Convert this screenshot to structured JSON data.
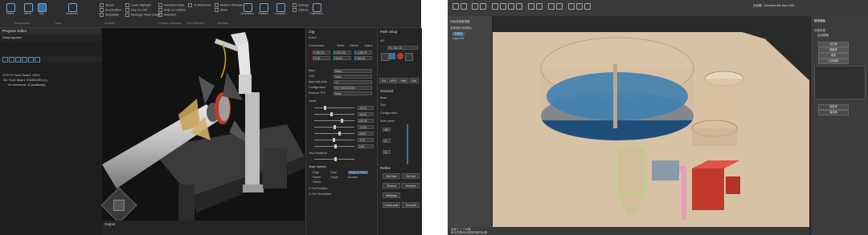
{
  "left_app": {
    "ribbon": {
      "buttons": [
        {
          "label": "Select",
          "icon": "cursor-icon"
        },
        {
          "label": "Move",
          "icon": "move-icon"
        },
        {
          "label": "Jog",
          "icon": "jog-icon"
        },
        {
          "label": "Geometry",
          "icon": "geometry-icon"
        }
      ],
      "options": [
        "Speed",
        "Acceleration",
        "Singularity",
        "Lower Highlight",
        "Stop at Limit",
        "Message Panel Output",
        "Selection Active",
        "Snap on collision",
        "Detection",
        "To Reference",
        "Restore Windows",
        "Show"
      ],
      "options_right": [
        "Settings",
        "Options"
      ],
      "groups": [
        "Manipulation",
        "Tools",
        "Visibility",
        "Common Selection",
        "Live Selection",
        "Windows"
      ],
      "group_right": [
        "Simulation",
        "Feature",
        "Compiler",
        "Calibration",
        "Stability"
      ]
    },
    "program_editor": {
      "title": "Program Editor",
      "tab": "Subprograms",
      "rows": [
        "PTP P1 Tool1 Base1 100%",
        "W1 Tool1 Base1 STANDARD (1)",
        "No reference, 11 position(s)"
      ]
    },
    "output": {
      "title": "Output"
    },
    "jog": {
      "title": "Jog",
      "robot": "Robot",
      "coordinates_label": "Coordinates",
      "coord_modes": [
        "World",
        "Parent",
        "Object"
      ],
      "coord_values": [
        "1250.00",
        "2150.00",
        "-1280.00",
        "0.00",
        "90.00",
        "180.00"
      ],
      "fields": [
        {
          "label": "Base",
          "value": "Base1"
        },
        {
          "label": "Tool",
          "value": "Tool1"
        },
        {
          "label": "Approach Axis",
          "value": "+Z"
        },
        {
          "label": "Configuration",
          "value": "FUT 000 000 000"
        },
        {
          "label": "External TCP",
          "value": "None"
        }
      ],
      "joints_label": "Joints",
      "joint_values": [
        "-43.10",
        "-65.40",
        "115.50",
        "-10.20",
        "38.90",
        "-5.70",
        "0.00"
      ],
      "two_positioner": "Two Positioner",
      "snap_options": "Snap Options",
      "snap_modes": [
        "Edge",
        "Face",
        "Frame",
        "Origin",
        "Vertex",
        "Bounds",
        "Edge & Face"
      ],
      "set_position": "Set Position",
      "set_orientation": "Set Orientation"
    },
    "path_setup": {
      "title": "Path setup",
      "name": "W1",
      "pose": "P1, Via, 15",
      "tabs": [
        "Ext",
        "WPS",
        "Path",
        "Rail"
      ],
      "general": "General",
      "general_fields": [
        "Base",
        "Tool",
        "Configuration",
        "Work piece"
      ],
      "values": [
        "450",
        "00",
        "10"
      ],
      "refine": "Refine",
      "refine_buttons": [
        "Set Start",
        "Set End",
        "Tearout",
        "Reverse",
        "Multipass",
        "Check path",
        "Tool path"
      ]
    }
  },
  "right_app": {
    "title_bar": "无标题 - Autodesk 3ds Max 2020",
    "left_panel": [
      "场景资源管理器",
      "名称(按升序排序)",
      "对象组",
      "Layer001"
    ],
    "side_panel": {
      "title": "修改面板",
      "items": [
        "对象类型",
        "自动栅格"
      ],
      "buttons": [
        "长方体",
        "圆锥体",
        "球体",
        "几何球体",
        "圆柱体",
        "管状体"
      ]
    },
    "status": [
      "选择了 1 个对象",
      "单击并拖动以选择并移动对象"
    ]
  }
}
